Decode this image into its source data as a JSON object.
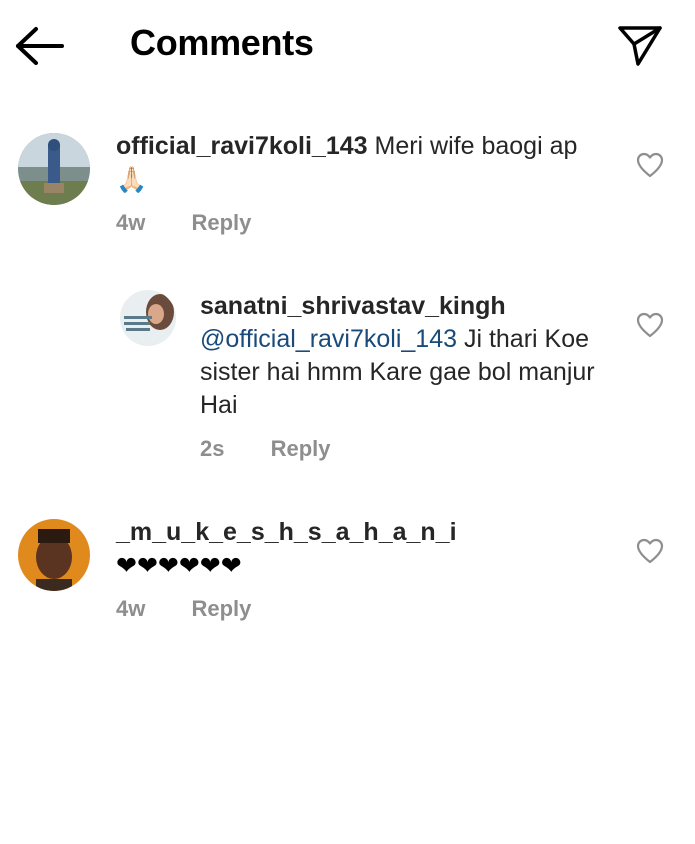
{
  "header": {
    "title": "Comments",
    "back_icon": "arrow-left-icon",
    "share_icon": "paper-plane-icon"
  },
  "comments": [
    {
      "username": "official_ravi7koli_143",
      "text": "Meri wife baogi ap",
      "emoji": "🙏🏻",
      "time": "4w",
      "reply_label": "Reply"
    },
    {
      "username": "sanatni_shrivastav_kingh",
      "mention": "@official_ravi7koli_143",
      "text": " Ji thari Koe sister hai hmm  Kare gae bol manjur Hai",
      "time": "2s",
      "reply_label": "Reply"
    },
    {
      "username": "_m_u_k_e_s_h_s_a_h_a_n_i",
      "text": "❤❤❤❤❤❤",
      "time": "4w",
      "reply_label": "Reply"
    }
  ],
  "colors": {
    "text": "#262626",
    "meta": "#8e8e8e",
    "mention": "#1a4a7a",
    "heart_outline": "#8e8e8e"
  }
}
